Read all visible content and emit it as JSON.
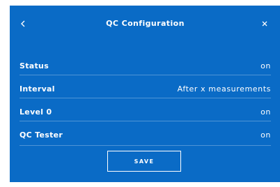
{
  "dialog": {
    "title": "QC Configuration",
    "back_icon": "chevron-left-icon",
    "close_icon": "close-icon",
    "background_color": "#0a6bc6"
  },
  "rows": [
    {
      "label": "Status",
      "value": "on"
    },
    {
      "label": "Interval",
      "value": "After x measurements"
    },
    {
      "label": "Level 0",
      "value": "on"
    },
    {
      "label": "QC Tester",
      "value": "on"
    }
  ],
  "footer": {
    "save_label": "SAVE"
  }
}
